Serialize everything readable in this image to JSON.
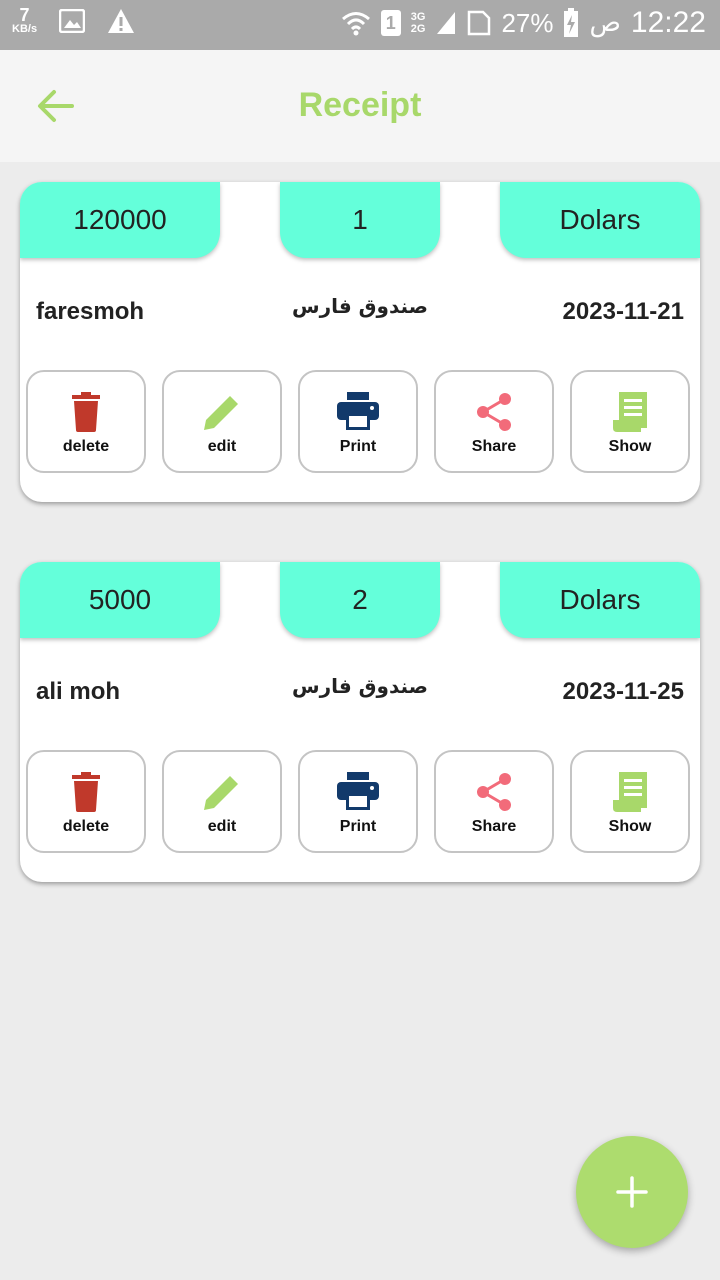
{
  "status_bar": {
    "speed_value": "7",
    "speed_unit": "KB/s",
    "sim_slot": "1",
    "network_top": "3G",
    "network_bottom": "2G",
    "battery": "27%",
    "am_pm": "ص",
    "time": "12:22"
  },
  "header": {
    "title": "Receipt"
  },
  "receipts": [
    {
      "amount": "120000",
      "number": "1",
      "currency": "Dolars",
      "name": "faresmoh",
      "fund": "صندوق فارس",
      "date": "2023-11-21"
    },
    {
      "amount": "5000",
      "number": "2",
      "currency": "Dolars",
      "name": "ali moh",
      "fund": "صندوق فارس",
      "date": "2023-11-25"
    }
  ],
  "actions": {
    "delete": "delete",
    "edit": "edit",
    "print": "Print",
    "share": "Share",
    "show": "Show"
  },
  "colors": {
    "accent": "#a8d86a",
    "tab": "#64ffda",
    "delete": "#c0392b",
    "edit": "#a8d86a",
    "print": "#123a6b",
    "share": "#f26b7a",
    "show": "#a8d86a"
  },
  "icons": {
    "back": "arrow-left-icon",
    "delete": "trash-icon",
    "edit": "pencil-icon",
    "print": "printer-icon",
    "share": "share-icon",
    "show": "receipt-icon",
    "fab": "plus-icon"
  }
}
